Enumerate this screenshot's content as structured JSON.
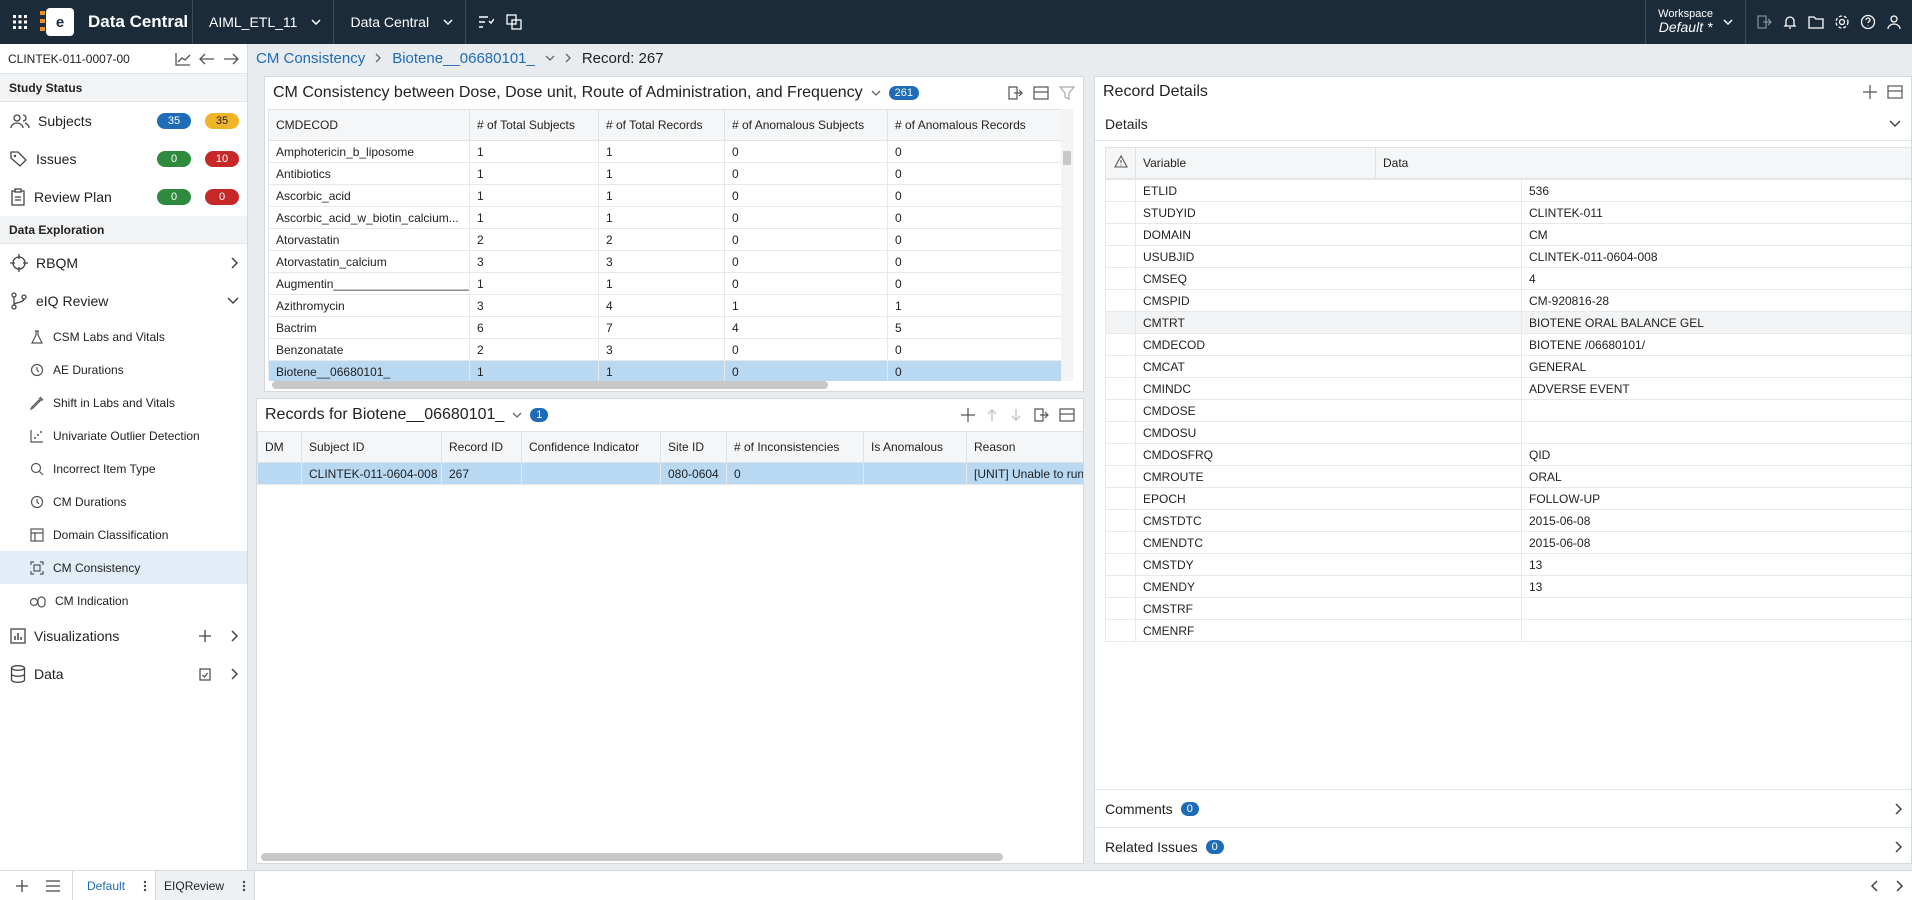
{
  "topbar": {
    "app_title": "Data Central",
    "logo_letter": "e",
    "dropdown1": "AIML_ETL_11",
    "dropdown2": "Data Central",
    "workspace_label": "Workspace",
    "workspace_value": "Default",
    "workspace_mark": "*"
  },
  "sidebar": {
    "study_id": "CLINTEK-011-0007-00",
    "study_status_title": "Study Status",
    "status_rows": [
      {
        "label": "Subjects",
        "a": "35",
        "b": "35"
      },
      {
        "label": "Issues",
        "a": "0",
        "b": "10"
      },
      {
        "label": "Review Plan",
        "a": "0",
        "b": "0"
      }
    ],
    "exploration_title": "Data Exploration",
    "rbqm": "RBQM",
    "eiq_review": "eIQ Review",
    "sub_items": [
      "CSM Labs and Vitals",
      "AE Durations",
      "Shift in Labs and Vitals",
      "Univariate Outlier Detection",
      "Incorrect Item Type",
      "CM Durations",
      "Domain Classification",
      "CM Consistency",
      "CM Indication"
    ],
    "visualizations": "Visualizations",
    "data": "Data"
  },
  "breadcrumb": {
    "item1": "CM Consistency",
    "item2": "Biotene__06680101_",
    "item3": "Record: 267"
  },
  "top_panel": {
    "title": "CM Consistency between Dose, Dose unit, Route of Administration, and Frequency",
    "count": "261",
    "columns": [
      "CMDECOD",
      "# of Total Subjects",
      "# of Total Records",
      "# of Anomalous Subjects",
      "# of Anomalous Records"
    ],
    "rows": [
      [
        "Amphotericin_b_liposome",
        "1",
        "1",
        "0",
        "0"
      ],
      [
        "Antibiotics",
        "1",
        "1",
        "0",
        "0"
      ],
      [
        "Ascorbic_acid",
        "1",
        "1",
        "0",
        "0"
      ],
      [
        "Ascorbic_acid_w_biotin_calcium...",
        "1",
        "1",
        "0",
        "0"
      ],
      [
        "Atorvastatin",
        "2",
        "2",
        "0",
        "0"
      ],
      [
        "Atorvastatin_calcium",
        "3",
        "3",
        "0",
        "0"
      ],
      [
        "Augmentin______________________",
        "1",
        "1",
        "0",
        "0"
      ],
      [
        "Azithromycin",
        "3",
        "4",
        "1",
        "1"
      ],
      [
        "Bactrim",
        "6",
        "7",
        "4",
        "5"
      ],
      [
        "Benzonatate",
        "2",
        "3",
        "0",
        "0"
      ],
      [
        "Biotene__06680101_",
        "1",
        "1",
        "0",
        "0"
      ]
    ]
  },
  "bottom_panel": {
    "title": "Records for Biotene__06680101_",
    "count": "1",
    "columns": [
      "DM",
      "Subject ID",
      "Record ID",
      "Confidence Indicator",
      "Site ID",
      "# of Inconsistencies",
      "Is Anomalous",
      "Reason"
    ],
    "rows": [
      [
        "",
        "CLINTEK-011-0604-008",
        "267",
        "",
        "080-0604",
        "0",
        "",
        "[UNIT] Unable to run"
      ]
    ]
  },
  "record_details": {
    "title": "Record Details",
    "section": "Details",
    "col_variable": "Variable",
    "col_data": "Data",
    "rows": [
      [
        "ETLID",
        "536"
      ],
      [
        "STUDYID",
        "CLINTEK-011"
      ],
      [
        "DOMAIN",
        "CM"
      ],
      [
        "USUBJID",
        "CLINTEK-011-0604-008"
      ],
      [
        "CMSEQ",
        "4"
      ],
      [
        "CMSPID",
        "CM-920816-28"
      ],
      [
        "CMTRT",
        "BIOTENE ORAL BALANCE GEL"
      ],
      [
        "CMDECOD",
        "BIOTENE /06680101/"
      ],
      [
        "CMCAT",
        "GENERAL"
      ],
      [
        "CMINDC",
        "ADVERSE EVENT"
      ],
      [
        "CMDOSE",
        ""
      ],
      [
        "CMDOSU",
        ""
      ],
      [
        "CMDOSFRQ",
        "QID"
      ],
      [
        "CMROUTE",
        "ORAL"
      ],
      [
        "EPOCH",
        "FOLLOW-UP"
      ],
      [
        "CMSTDTC",
        "2015-06-08"
      ],
      [
        "CMENDTC",
        "2015-06-08"
      ],
      [
        "CMSTDY",
        "13"
      ],
      [
        "CMENDY",
        "13"
      ],
      [
        "CMSTRF",
        ""
      ],
      [
        "CMENRF",
        ""
      ]
    ],
    "comments_label": "Comments",
    "comments_count": "0",
    "related_label": "Related Issues",
    "related_count": "0"
  },
  "bottombar": {
    "tab1": "Default",
    "tab2": "EIQReview"
  }
}
